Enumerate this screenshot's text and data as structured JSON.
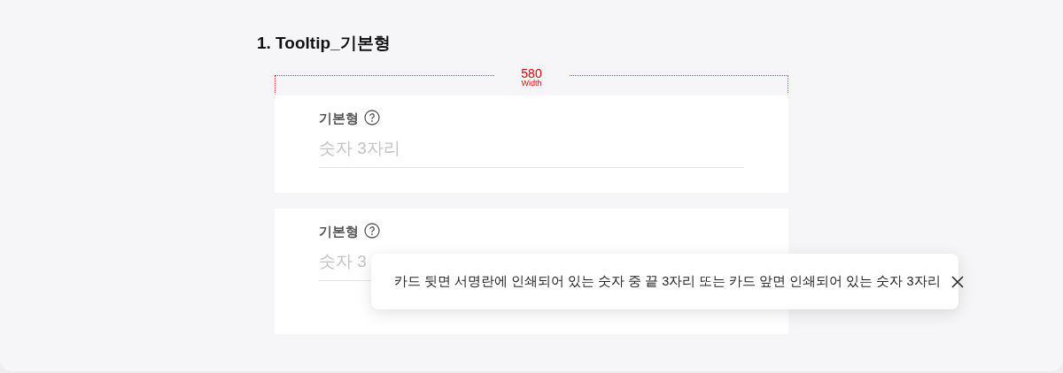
{
  "section_title": "1. Tooltip_기본형",
  "dimension": {
    "value": "580",
    "label": "Width"
  },
  "fields": [
    {
      "label": "기본형",
      "placeholder": "숫자 3자리"
    },
    {
      "label": "기본형",
      "placeholder": "숫자 3",
      "tooltip": {
        "text": "카드 뒷면 서명란에 인쇄되어 있는 숫자 중 끝 3자리 또는 카드 앞면 인쇄되어 있는 숫자 3자리"
      }
    }
  ]
}
